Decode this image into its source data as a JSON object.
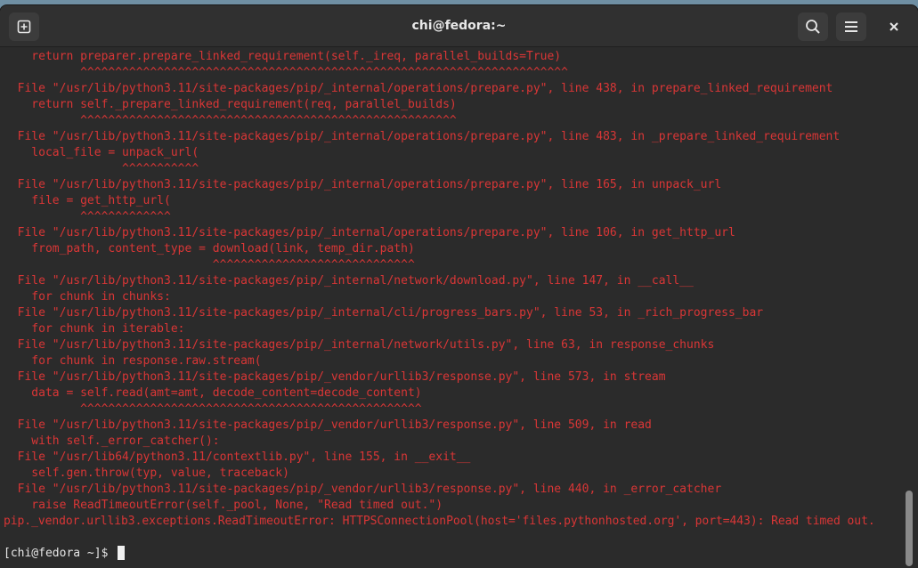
{
  "window": {
    "title": "chi@fedora:~"
  },
  "icons": {
    "new_tab": "new-tab-icon",
    "search": "search-icon",
    "menu": "hamburger-menu-icon",
    "close": "close-icon"
  },
  "colors": {
    "error_text": "#d93636",
    "prompt_text": "#e6e6e6",
    "background": "#2b2b2b",
    "titlebar": "#303030"
  },
  "terminal": {
    "lines": [
      "    return preparer.prepare_linked_requirement(self._ireq, parallel_builds=True)",
      "           ^^^^^^^^^^^^^^^^^^^^^^^^^^^^^^^^^^^^^^^^^^^^^^^^^^^^^^^^^^^^^^^^^^^^^^",
      "  File \"/usr/lib/python3.11/site-packages/pip/_internal/operations/prepare.py\", line 438, in prepare_linked_requirement",
      "    return self._prepare_linked_requirement(req, parallel_builds)",
      "           ^^^^^^^^^^^^^^^^^^^^^^^^^^^^^^^^^^^^^^^^^^^^^^^^^^^^^^",
      "  File \"/usr/lib/python3.11/site-packages/pip/_internal/operations/prepare.py\", line 483, in _prepare_linked_requirement",
      "    local_file = unpack_url(",
      "                 ^^^^^^^^^^^",
      "  File \"/usr/lib/python3.11/site-packages/pip/_internal/operations/prepare.py\", line 165, in unpack_url",
      "    file = get_http_url(",
      "           ^^^^^^^^^^^^^",
      "  File \"/usr/lib/python3.11/site-packages/pip/_internal/operations/prepare.py\", line 106, in get_http_url",
      "    from_path, content_type = download(link, temp_dir.path)",
      "                              ^^^^^^^^^^^^^^^^^^^^^^^^^^^^^",
      "  File \"/usr/lib/python3.11/site-packages/pip/_internal/network/download.py\", line 147, in __call__",
      "    for chunk in chunks:",
      "  File \"/usr/lib/python3.11/site-packages/pip/_internal/cli/progress_bars.py\", line 53, in _rich_progress_bar",
      "    for chunk in iterable:",
      "  File \"/usr/lib/python3.11/site-packages/pip/_internal/network/utils.py\", line 63, in response_chunks",
      "    for chunk in response.raw.stream(",
      "  File \"/usr/lib/python3.11/site-packages/pip/_vendor/urllib3/response.py\", line 573, in stream",
      "    data = self.read(amt=amt, decode_content=decode_content)",
      "           ^^^^^^^^^^^^^^^^^^^^^^^^^^^^^^^^^^^^^^^^^^^^^^^^^",
      "  File \"/usr/lib/python3.11/site-packages/pip/_vendor/urllib3/response.py\", line 509, in read",
      "    with self._error_catcher():",
      "  File \"/usr/lib64/python3.11/contextlib.py\", line 155, in __exit__",
      "    self.gen.throw(typ, value, traceback)",
      "  File \"/usr/lib/python3.11/site-packages/pip/_vendor/urllib3/response.py\", line 440, in _error_catcher",
      "    raise ReadTimeoutError(self._pool, None, \"Read timed out.\")",
      "pip._vendor.urllib3.exceptions.ReadTimeoutError: HTTPSConnectionPool(host='files.pythonhosted.org', port=443): Read timed out."
    ],
    "prompt": "[chi@fedora ~]$ "
  }
}
